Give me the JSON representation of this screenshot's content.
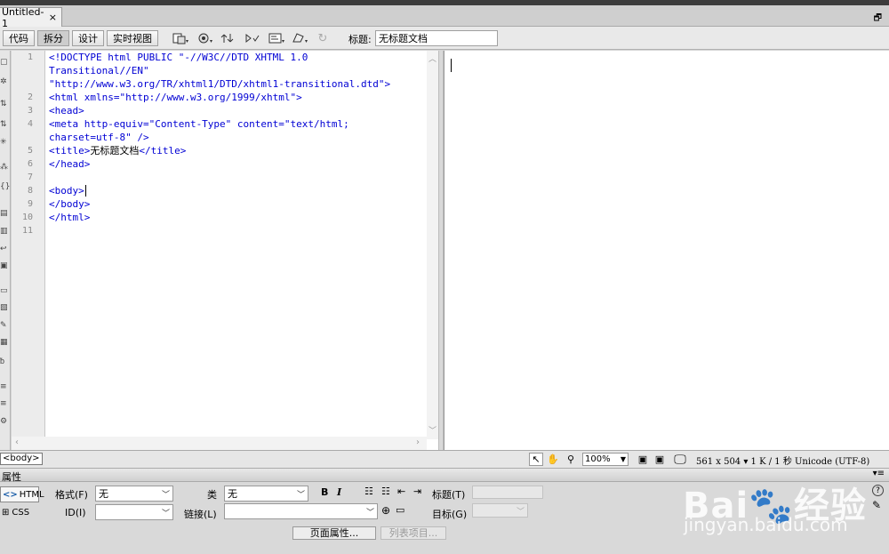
{
  "document": {
    "tab_label": "Untitled-1",
    "close_glyph": "×",
    "restore_glyph": "🗗"
  },
  "toolbar": {
    "view_buttons": [
      "代码",
      "拆分",
      "设计",
      "实时视图"
    ],
    "title_label": "标题:",
    "title_value": "无标题文档"
  },
  "code": {
    "line_numbers": [
      "1",
      "",
      "",
      "2",
      "3",
      "4",
      "",
      "5",
      "6",
      "7",
      "8",
      "9",
      "10",
      "11"
    ],
    "lines": [
      "<!DOCTYPE html PUBLIC \"-//W3C//DTD XHTML 1.0",
      "Transitional//EN\"",
      "\"http://www.w3.org/TR/xhtml1/DTD/xhtml1-transitional.dtd\">",
      "<html xmlns=\"http://www.w3.org/1999/xhtml\">",
      "<head>",
      "<meta http-equiv=\"Content-Type\" content=\"text/html;",
      "charset=utf-8\" />",
      "",
      "</head>",
      "",
      "<body>",
      "</body>",
      "</html>",
      ""
    ],
    "title_line": {
      "open": "<title>",
      "text": "无标题文档",
      "close": "</title>"
    }
  },
  "statusbar": {
    "tag": "<body>",
    "zoom": "100%",
    "info": "561 x 504 ▾ 1 K / 1 秒 Unicode (UTF-8)"
  },
  "properties": {
    "panel_title": "属性",
    "html_label": "HTML",
    "css_label": "CSS",
    "format_label": "格式(F)",
    "format_value": "无",
    "class_label": "类",
    "class_value": "无",
    "id_label": "ID(I)",
    "id_value": "",
    "link_label": "链接(L)",
    "link_value": "",
    "heading_label": "标题(T)",
    "target_label": "目标(G)",
    "bold": "B",
    "italic": "I",
    "page_props_button": "页面属性...",
    "list_item_button": "列表项目..."
  },
  "watermark": {
    "logo": "Bai🐾经验",
    "url": "jingyan.baidu.com"
  },
  "icons": [
    "close-icon",
    "restore-icon",
    "file-management-icon",
    "preview-icon",
    "refresh-icon",
    "validate-icon",
    "visual-aids-icon",
    "check-browser-icon",
    "refresh-design-icon",
    "select-icon",
    "hand-icon",
    "zoom-icon",
    "help-icon",
    "edit-icon"
  ]
}
